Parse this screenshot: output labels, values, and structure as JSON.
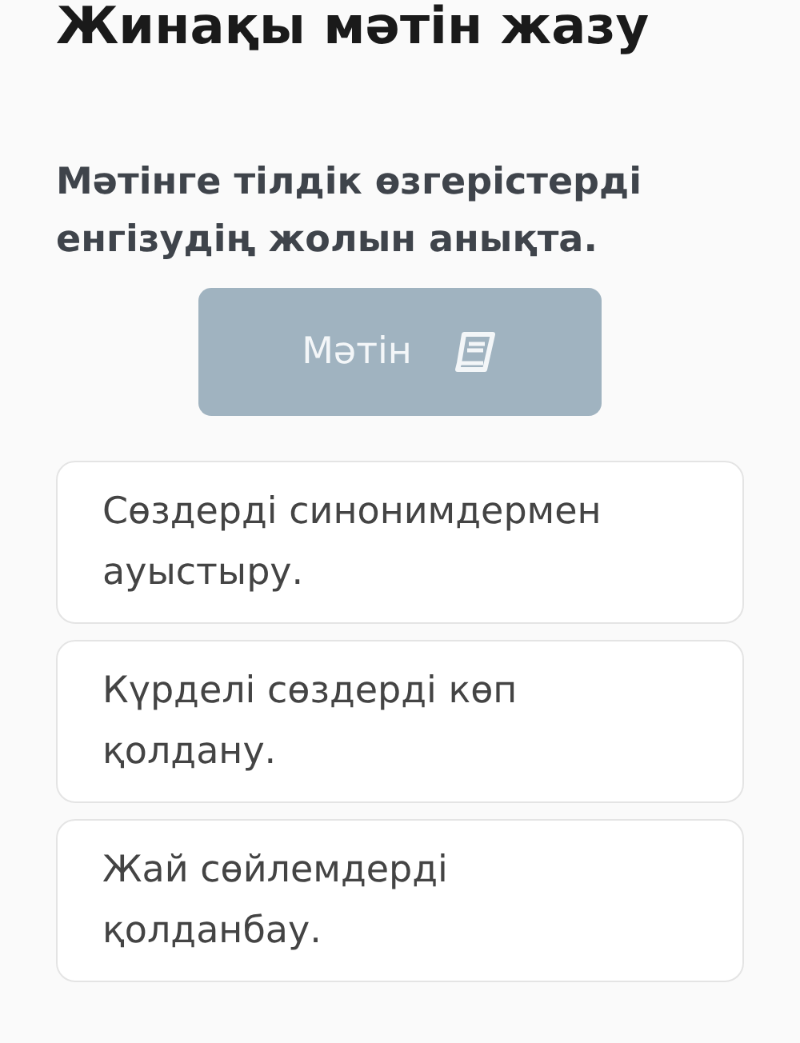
{
  "title": "Жинақы мәтін жазу",
  "question": "Мәтінге тілдік өзгерістерді енгізудің жолын анықта.",
  "text_button": {
    "label": "Мәтін"
  },
  "options": [
    {
      "text": "Сөздерді синонимдермен ауыстыру."
    },
    {
      "text": "Күрделі сөздерді көп қолдану."
    },
    {
      "text": "Жай сөйлемдерді қолданбау."
    }
  ]
}
